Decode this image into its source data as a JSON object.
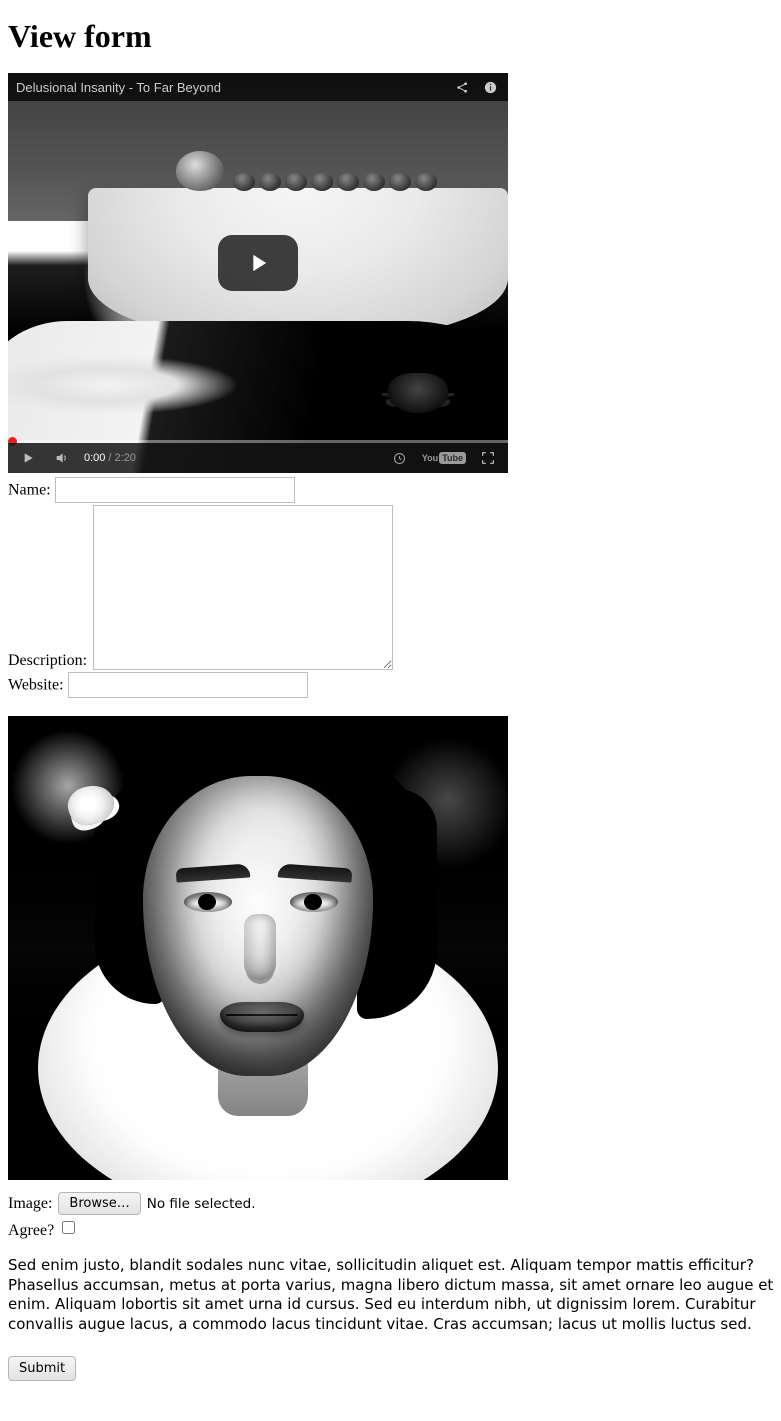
{
  "page": {
    "title": "View form"
  },
  "video": {
    "title": "Delusional Insanity - To Far Beyond",
    "current_time": "0:00",
    "duration": "2:20",
    "brand_prefix": "You",
    "brand_suffix": "Tube",
    "icons": {
      "share": "share-icon",
      "info": "info-icon",
      "play": "play-icon",
      "volume": "volume-icon",
      "watch_later": "watch-later-icon",
      "fullscreen": "fullscreen-icon",
      "big_play": "big-play-icon"
    }
  },
  "form": {
    "name_label": "Name:",
    "name_value": "",
    "description_label": "Description:",
    "description_value": "",
    "website_label": "Website:",
    "website_value": "",
    "image_label": "Image:",
    "browse_label": "Browse…",
    "file_status": "No file selected.",
    "agree_label": "Agree?",
    "agree_checked": false,
    "submit_label": "Submit"
  },
  "paragraph": "Sed enim justo, blandit sodales nunc vitae, sollicitudin aliquet est. Aliquam tempor mattis efficitur? Phasellus accumsan, metus at porta varius, magna libero dictum massa, sit amet ornare leo augue et enim. Aliquam lobortis sit amet urna id cursus. Sed eu interdum nibh, ut dignissim lorem. Curabitur convallis augue lacus, a commodo lacus tincidunt vitae. Cras accumsan; lacus ut mollis luctus sed."
}
